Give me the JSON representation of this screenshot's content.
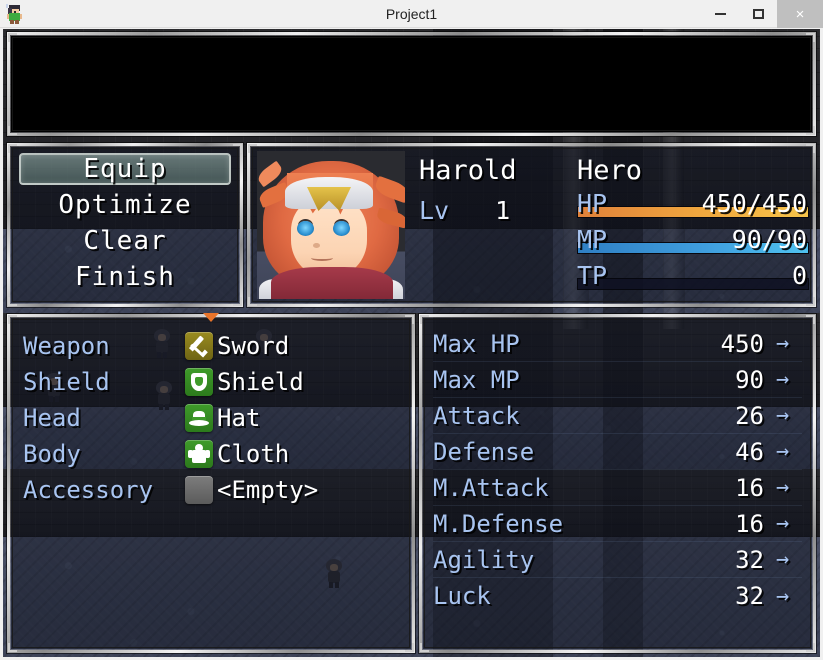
{
  "titlebar": {
    "title": "Project1",
    "app_icon": "rpgmaker-character-icon",
    "minimize_label": "",
    "maximize_label": "",
    "close_label": "×"
  },
  "help_window": {
    "text": ""
  },
  "command_window": {
    "items": [
      {
        "label": "Equip",
        "selected": true
      },
      {
        "label": "Optimize",
        "selected": false
      },
      {
        "label": "Clear",
        "selected": false
      },
      {
        "label": "Finish",
        "selected": false
      }
    ]
  },
  "status_window": {
    "actor_name": "Harold",
    "class_name": "Hero",
    "level_label": "Lv",
    "level_value": "1",
    "gauges": [
      {
        "label": "HP",
        "value": "450/450",
        "percent": 100,
        "color": "#f0a83f",
        "kind": "hp"
      },
      {
        "label": "MP",
        "value": "90/90",
        "percent": 100,
        "color": "#3f9ede",
        "kind": "mp"
      },
      {
        "label": "TP",
        "value": "0",
        "percent": 0,
        "color": "#3fc79a",
        "kind": "tp"
      }
    ]
  },
  "slot_window": {
    "rows": [
      {
        "slot": "Weapon",
        "icon": "sword-icon",
        "icon_style": "sword",
        "item": "Sword"
      },
      {
        "slot": "Shield",
        "icon": "shield-icon",
        "icon_style": "green",
        "item": "Shield"
      },
      {
        "slot": "Head",
        "icon": "hat-icon",
        "icon_style": "green",
        "item": "Hat"
      },
      {
        "slot": "Body",
        "icon": "cloth-icon",
        "icon_style": "green",
        "item": "Cloth"
      },
      {
        "slot": "Accessory",
        "icon": "empty-icon",
        "icon_style": "empty",
        "item": "<Empty>"
      }
    ]
  },
  "param_window": {
    "arrow": "→",
    "rows": [
      {
        "name": "Max HP",
        "value": "450"
      },
      {
        "name": "Max MP",
        "value": "90"
      },
      {
        "name": "Attack",
        "value": "26"
      },
      {
        "name": "Defense",
        "value": "46"
      },
      {
        "name": "M.Attack",
        "value": "16"
      },
      {
        "name": "M.Defense",
        "value": "16"
      },
      {
        "name": "Agility",
        "value": "32"
      },
      {
        "name": "Luck",
        "value": "32"
      }
    ]
  },
  "theme": {
    "label_color": "#a8c4f0",
    "text_color": "#ffffff",
    "cursor_color": "#8fb0aa",
    "window_bg": "#101424",
    "hp_color": "#f0a83f",
    "mp_color": "#3f9ede",
    "tp_color": "#3fc79a",
    "arrow_color": "#e8742a"
  }
}
